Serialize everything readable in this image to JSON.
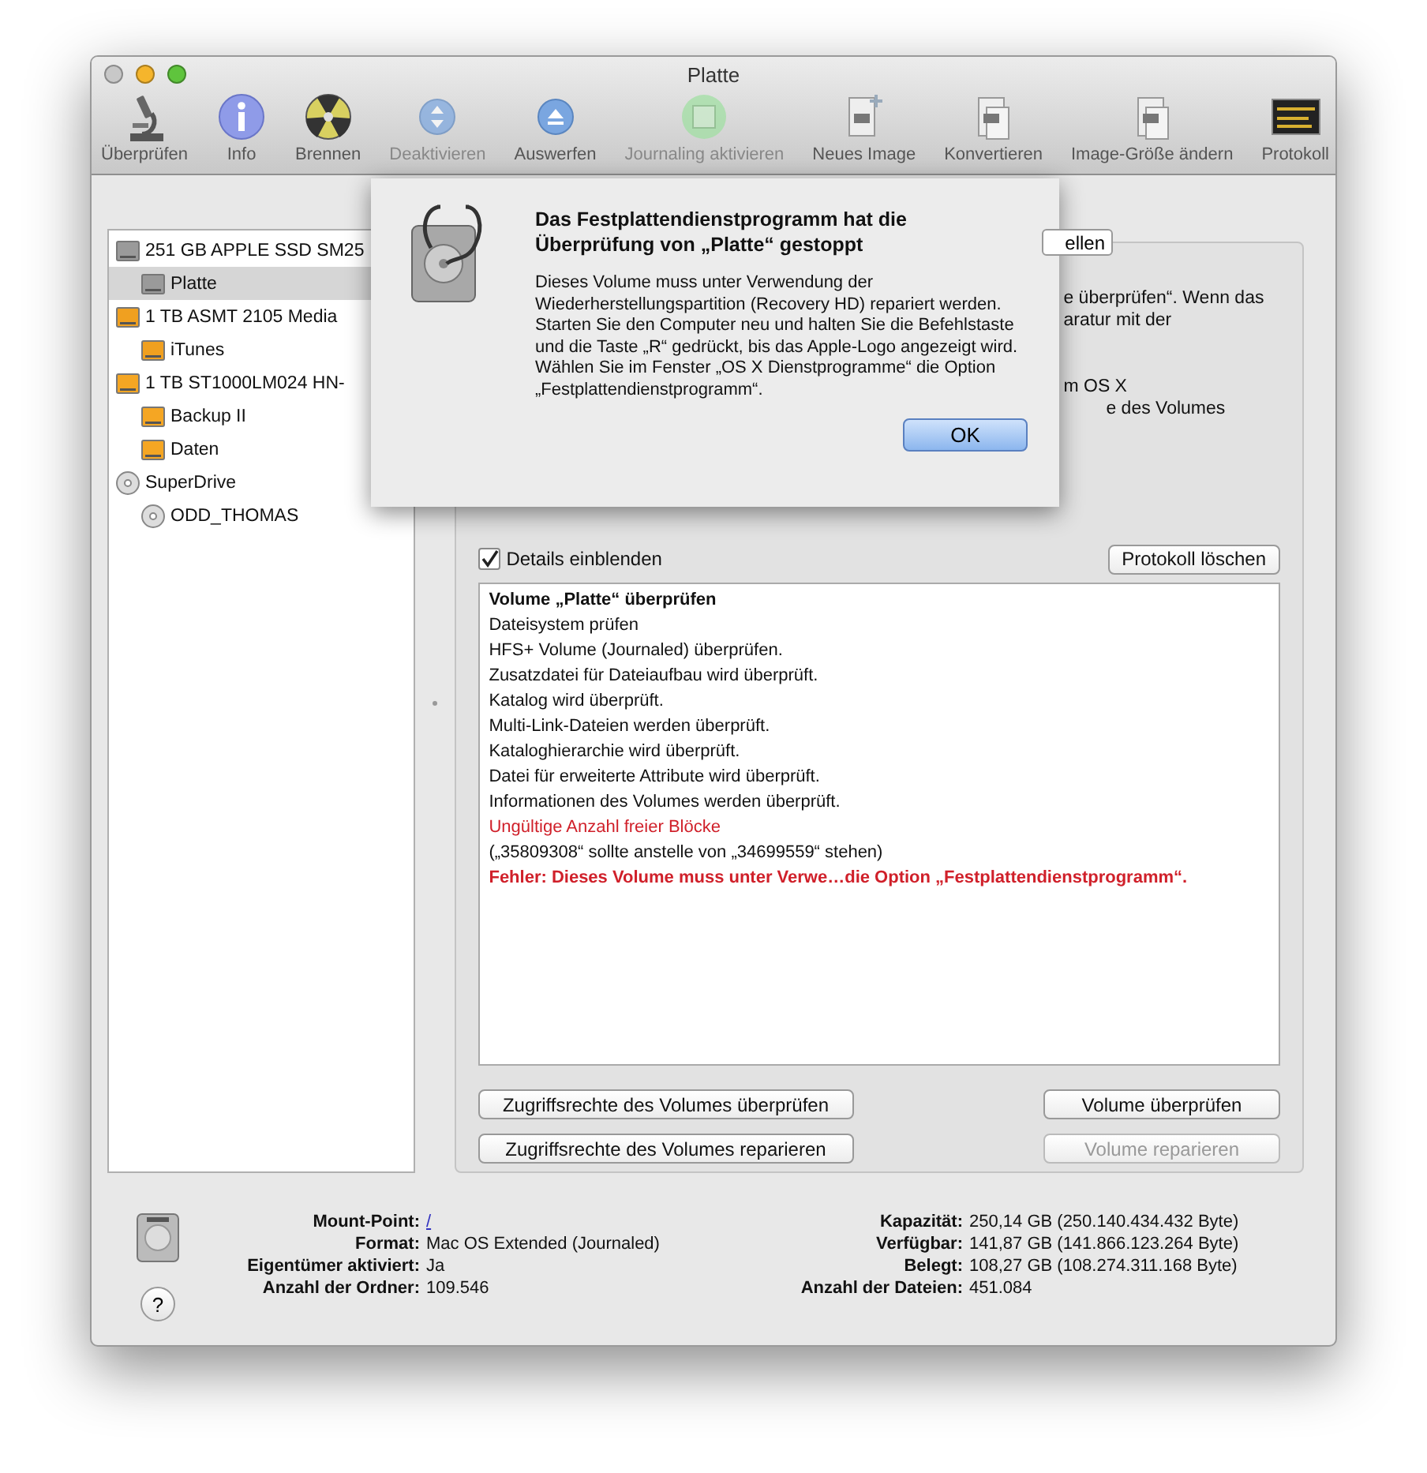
{
  "window": {
    "title": "Platte"
  },
  "toolbar": [
    {
      "kind": "microscope",
      "label": "Überprüfen",
      "disabled": false
    },
    {
      "kind": "info",
      "label": "Info",
      "disabled": false
    },
    {
      "kind": "burn",
      "label": "Brennen",
      "disabled": false
    },
    {
      "kind": "unmount",
      "label": "Deaktivieren",
      "disabled": true
    },
    {
      "kind": "eject",
      "label": "Auswerfen",
      "disabled": false
    },
    {
      "kind": "journal",
      "label": "Journaling aktivieren",
      "disabled": true
    },
    {
      "kind": "new-image",
      "label": "Neues Image",
      "disabled": false
    },
    {
      "kind": "convert",
      "label": "Konvertieren",
      "disabled": false
    },
    {
      "kind": "resize",
      "label": "Image-Größe ändern",
      "disabled": false
    },
    {
      "kind": "log",
      "label": "Protokoll",
      "disabled": false
    }
  ],
  "sidebar": {
    "items": [
      {
        "kind": "ssd",
        "label": "251 GB APPLE SSD SM25",
        "selected": false,
        "children": [
          {
            "kind": "ssd",
            "label": "Platte",
            "selected": true
          }
        ]
      },
      {
        "kind": "usb",
        "label": "1 TB ASMT 2105 Media",
        "selected": false,
        "children": [
          {
            "kind": "usb",
            "label": "iTunes",
            "selected": false
          }
        ]
      },
      {
        "kind": "external",
        "label": "1 TB ST1000LM024 HN-",
        "selected": false,
        "children": [
          {
            "kind": "external",
            "label": "Backup II",
            "selected": false
          },
          {
            "kind": "external",
            "label": "Daten",
            "selected": false
          }
        ]
      },
      {
        "kind": "disc",
        "label": "SuperDrive",
        "selected": false,
        "children": [
          {
            "kind": "disc",
            "label": "ODD_THOMAS",
            "selected": false
          }
        ]
      }
    ]
  },
  "panel": {
    "tab": "ellen",
    "background_text": [
      "e überprüfen“. Wenn das",
      "aratur mit der",
      "m OS X",
      "e des Volumes"
    ],
    "show_details": {
      "label": "Details einblenden",
      "checked": true
    },
    "clear_log_button": "Protokoll löschen",
    "log": [
      {
        "kind": "heading",
        "text": "Volume „Platte“ überprüfen"
      },
      {
        "kind": "normal",
        "text": "Dateisystem prüfen"
      },
      {
        "kind": "normal",
        "text": "HFS+ Volume (Journaled) überprüfen."
      },
      {
        "kind": "normal",
        "text": "Zusatzdatei für Dateiaufbau wird überprüft."
      },
      {
        "kind": "normal",
        "text": "Katalog wird überprüft."
      },
      {
        "kind": "normal",
        "text": "Multi-Link-Dateien werden überprüft."
      },
      {
        "kind": "normal",
        "text": "Kataloghierarchie wird überprüft."
      },
      {
        "kind": "normal",
        "text": "Datei für erweiterte Attribute wird überprüft."
      },
      {
        "kind": "normal",
        "text": "Informationen des Volumes werden überprüft."
      },
      {
        "kind": "warning",
        "text": "Ungültige Anzahl freier Blöcke"
      },
      {
        "kind": "normal",
        "text": "(„35809308“ sollte anstelle von „34699559“ stehen)"
      },
      {
        "kind": "error",
        "text": "Fehler: Dieses Volume muss unter Verwe…die Option „Festplattendienstprogramm“."
      }
    ],
    "buttons_left": [
      {
        "label": "Zugriffsrechte des Volumes überprüfen",
        "disabled": false
      },
      {
        "label": "Zugriffsrechte des Volumes reparieren",
        "disabled": false
      }
    ],
    "buttons_right": [
      {
        "label": "Volume überprüfen",
        "disabled": false
      },
      {
        "label": "Volume reparieren",
        "disabled": true
      }
    ]
  },
  "info": {
    "left": [
      {
        "label": "Mount-Point:",
        "value": "/",
        "link": true
      },
      {
        "label": "Format:",
        "value": "Mac OS Extended (Journaled)",
        "link": false
      },
      {
        "label": "Eigentümer aktiviert:",
        "value": "Ja",
        "link": false
      },
      {
        "label": "Anzahl der Ordner:",
        "value": "109.546",
        "link": false
      }
    ],
    "right": [
      {
        "label": "Kapazität:",
        "value": "250,14 GB (250.140.434.432 Byte)"
      },
      {
        "label": "Verfügbar:",
        "value": "141,87 GB (141.866.123.264 Byte)"
      },
      {
        "label": "Belegt:",
        "value": "108,27 GB (108.274.311.168 Byte)"
      },
      {
        "label": "Anzahl der Dateien:",
        "value": "451.084"
      }
    ],
    "help_button": "?"
  },
  "dialog": {
    "title": "Das Festplattendienstprogramm hat die Überprüfung von „Platte“ gestoppt",
    "message": "Dieses Volume muss unter Verwendung der Wiederherstellungspartition (Recovery HD) repariert werden. Starten Sie den Computer neu und halten Sie die Befehlstaste und die Taste „R“ gedrückt, bis das Apple-Logo angezeigt wird. Wählen Sie im Fenster „OS X Dienstprogramme“ die Option „Festplattendienstprogramm“.",
    "ok_button": "OK"
  }
}
